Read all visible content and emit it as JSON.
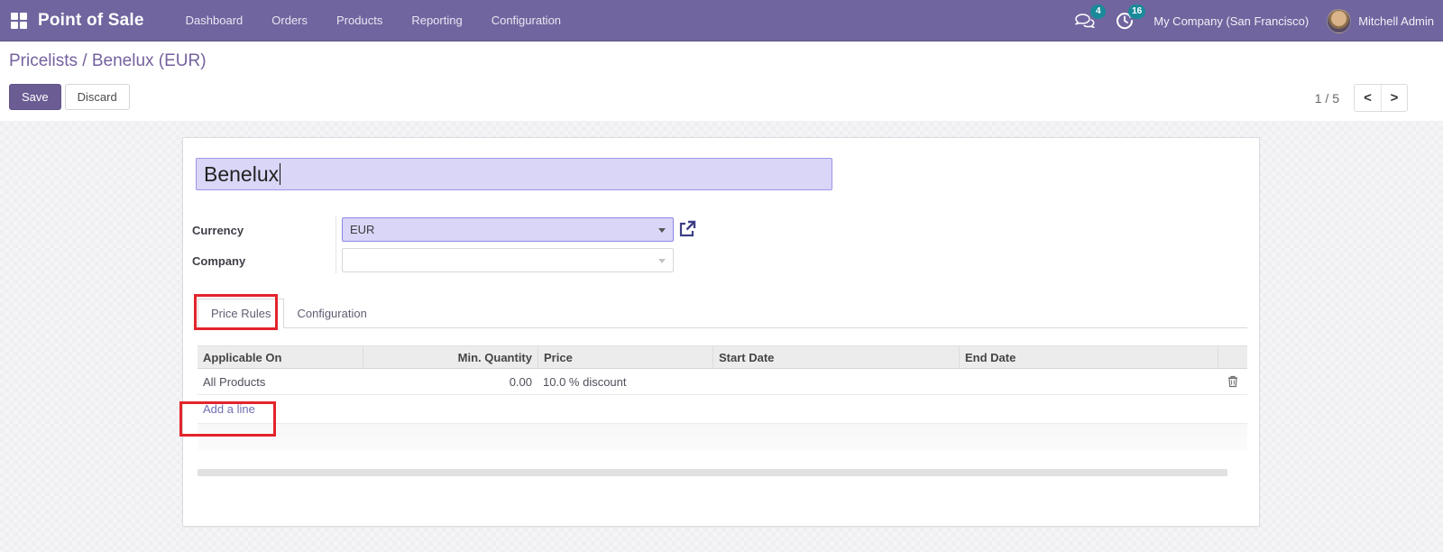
{
  "topbar": {
    "app_name": "Point of Sale",
    "menu_items": [
      "Dashboard",
      "Orders",
      "Products",
      "Reporting",
      "Configuration"
    ],
    "messages_count": "4",
    "activities_count": "16",
    "company": "My Company (San Francisco)",
    "user": "Mitchell Admin"
  },
  "control_panel": {
    "breadcrumb": {
      "parent": "Pricelists",
      "separator": " / ",
      "current": "Benelux (EUR)"
    },
    "save_label": "Save",
    "discard_label": "Discard",
    "pager": {
      "value": "1 / 5",
      "prev": "<",
      "next": ">"
    }
  },
  "form": {
    "name_value": "Benelux",
    "fields": [
      {
        "label": "Currency",
        "value": "EUR"
      },
      {
        "label": "Company",
        "value": ""
      }
    ],
    "tabs": [
      {
        "label": "Price Rules",
        "active": true
      },
      {
        "label": "Configuration",
        "active": false
      }
    ],
    "table": {
      "columns": [
        "Applicable On",
        "Min. Quantity",
        "Price",
        "Start Date",
        "End Date"
      ],
      "rows": [
        [
          "All Products",
          "0.00",
          "10.0 % discount",
          "",
          ""
        ]
      ],
      "add_line_label": "Add a line"
    }
  },
  "icons": {
    "apps": "grid",
    "messages": "speech-bubbles",
    "activities": "clock",
    "external": "open-in-new",
    "delete": "trash",
    "dropdown": "caret-down"
  },
  "colors": {
    "topbar_bg": "#70659e",
    "badge": "#1a8a99",
    "breadcrumb": "#75619e",
    "primary_button": "#6b5c93",
    "field_highlight": "#d9d6f7",
    "annotation_red": "#e3242b",
    "link": "#7170b0"
  }
}
